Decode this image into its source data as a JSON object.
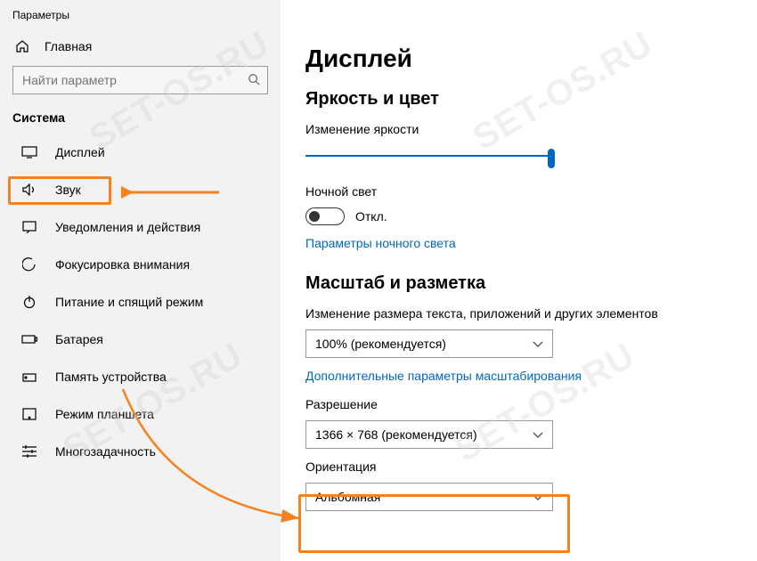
{
  "window_title": "Параметры",
  "watermark": "SET-OS.RU",
  "sidebar": {
    "home": "Главная",
    "search_placeholder": "Найти параметр",
    "section": "Система",
    "items": [
      {
        "label": "Дисплей",
        "icon": "display-icon",
        "selected": true
      },
      {
        "label": "Звук",
        "icon": "sound-icon"
      },
      {
        "label": "Уведомления и действия",
        "icon": "notifications-icon"
      },
      {
        "label": "Фокусировка внимания",
        "icon": "focus-icon"
      },
      {
        "label": "Питание и спящий режим",
        "icon": "power-icon"
      },
      {
        "label": "Батарея",
        "icon": "battery-icon"
      },
      {
        "label": "Память устройства",
        "icon": "storage-icon"
      },
      {
        "label": "Режим планшета",
        "icon": "tablet-icon"
      },
      {
        "label": "Многозадачность",
        "icon": "multitask-icon"
      }
    ]
  },
  "main": {
    "title": "Дисплей",
    "brightness": {
      "heading": "Яркость и цвет",
      "slider_label": "Изменение яркости",
      "value_percent": 100
    },
    "night_light": {
      "label": "Ночной свет",
      "state": "Откл.",
      "settings_link": "Параметры ночного света"
    },
    "scale": {
      "heading": "Масштаб и разметка",
      "size_label": "Изменение размера текста, приложений и других элементов",
      "size_value": "100% (рекомендуется)",
      "advanced_link": "Дополнительные параметры масштабирования",
      "resolution_label": "Разрешение",
      "resolution_value": "1366 × 768 (рекомендуется)",
      "orientation_label": "Ориентация",
      "orientation_value": "Альбомная"
    }
  },
  "colors": {
    "accent": "#0067c0",
    "highlight": "#f58220"
  }
}
